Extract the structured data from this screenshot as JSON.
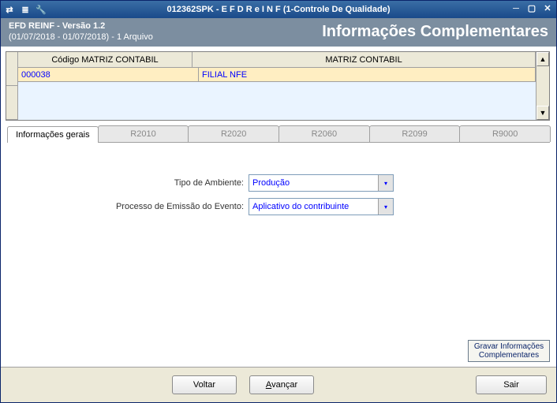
{
  "titlebar": {
    "title": "012362SPK - E F D   R e I N F (1-Controle De Qualidade)"
  },
  "subheader": {
    "line1": "EFD REINF - Versão 1.2",
    "line2": "(01/07/2018 - 01/07/2018) - 1 Arquivo",
    "right": "Informações Complementares"
  },
  "grid": {
    "headers": {
      "col1": "Código MATRIZ CONTABIL",
      "col2": "MATRIZ CONTABIL"
    },
    "rows": [
      {
        "codigo": "000038",
        "matriz": "FILIAL NFE"
      }
    ]
  },
  "tabs": {
    "t0": "Informações gerais",
    "t1": "R2010",
    "t2": "R2020",
    "t3": "R2060",
    "t4": "R2099",
    "t5": "R9000"
  },
  "form": {
    "tipo_ambiente_label": "Tipo de Ambiente:",
    "tipo_ambiente_value": "Produção",
    "processo_label": "Processo de Emissão do Evento:",
    "processo_value": "Aplicativo do contribuinte",
    "gravar_btn": "Gravar Informações Complementares"
  },
  "footer": {
    "voltar": "Voltar",
    "avancar": "vançar",
    "avancar_mn": "A",
    "sair": "Sair"
  }
}
